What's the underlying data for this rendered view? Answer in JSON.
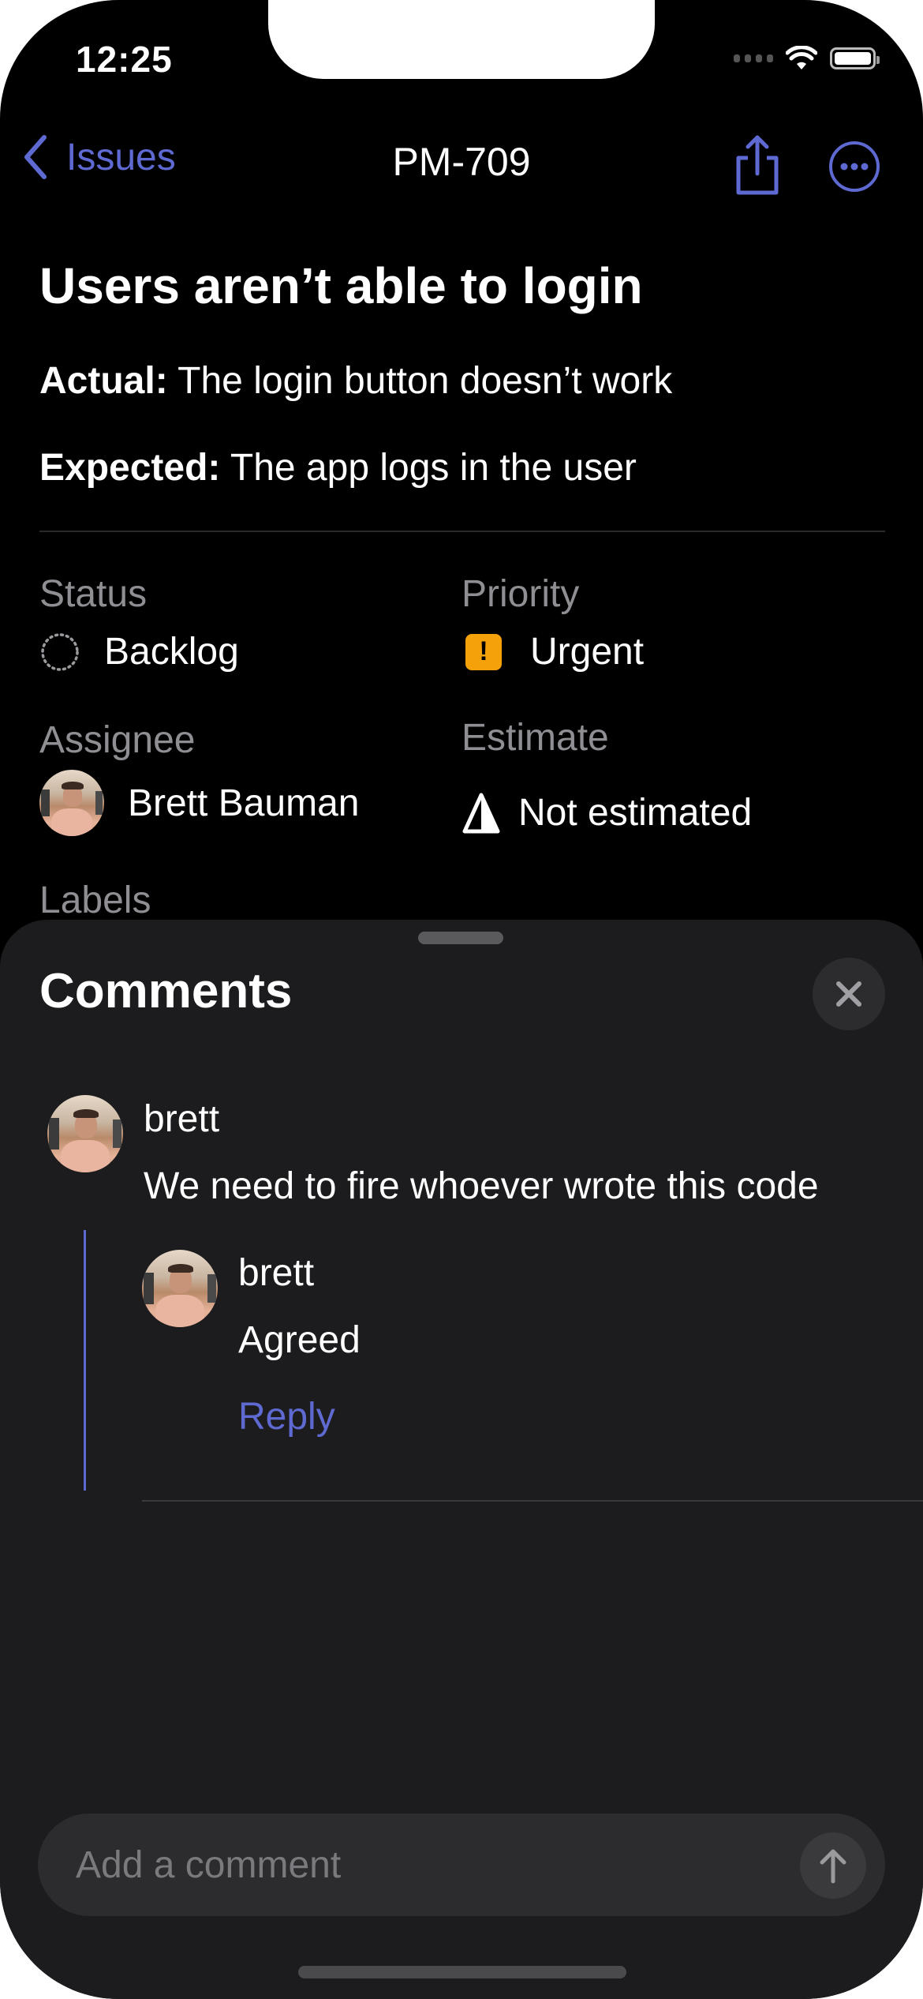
{
  "status_bar": {
    "time": "12:25"
  },
  "nav": {
    "back_label": "Issues",
    "title": "PM-709",
    "icons": [
      "chevron-left-icon",
      "share-icon",
      "ellipsis-circle-icon"
    ]
  },
  "issue": {
    "title": "Users aren’t able to login",
    "actual_label": "Actual:",
    "actual_text": " The login button doesn’t work",
    "expected_label": "Expected:",
    "expected_text": " The app logs in the user"
  },
  "properties": {
    "status": {
      "label": "Status",
      "value": "Backlog",
      "icon": "dotted-circle-icon"
    },
    "priority": {
      "label": "Priority",
      "value": "Urgent",
      "icon": "urgent-exclamation-icon",
      "color": "#f5a20a"
    },
    "assignee": {
      "label": "Assignee",
      "value": "Brett Bauman"
    },
    "estimate": {
      "label": "Estimate",
      "value": "Not estimated",
      "icon": "estimate-triangle-icon"
    },
    "labels": {
      "label": "Labels"
    }
  },
  "comments_sheet": {
    "title": "Comments",
    "comments": [
      {
        "author": "brett",
        "body": "We need to fire whoever wrote this code",
        "replies": [
          {
            "author": "brett",
            "body": "Agreed"
          }
        ],
        "reply_label": "Reply"
      }
    ],
    "composer": {
      "placeholder": "Add a comment",
      "value": ""
    }
  },
  "colors": {
    "accent": "#5e6ad2",
    "background": "#000000",
    "sheet": "#1c1c1e",
    "secondary_text": "#8e8e93",
    "urgent": "#f5a20a"
  }
}
